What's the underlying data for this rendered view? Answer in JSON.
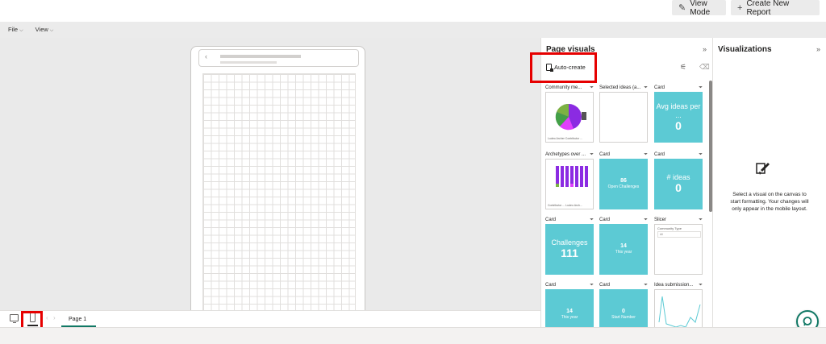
{
  "header": {
    "view_mode_label": "View Mode",
    "create_report_label": "Create New Report"
  },
  "menu": {
    "file_label": "File",
    "view_label": "View"
  },
  "status": {
    "page_tab_label": "Page 1"
  },
  "page_visuals": {
    "title": "Page visuals",
    "auto_create_label": "Auto-create",
    "tiles": [
      {
        "header": "Community me..."
      },
      {
        "header": "Selected ideas (a..."
      },
      {
        "header": "Card",
        "line1": "Avg ideas per ...",
        "value": "0"
      },
      {
        "header": "Archetypes over ..."
      },
      {
        "header": "Card",
        "value": "86",
        "caption": "Open Challenges"
      },
      {
        "header": "Card",
        "line1": "# ideas",
        "value": "0"
      },
      {
        "header": "Card",
        "line1": "Challenges",
        "value": "111"
      },
      {
        "header": "Card",
        "value": "14",
        "caption": "This year"
      },
      {
        "header": "Slicer",
        "slicer_label": "Community Type",
        "slicer_value": "All"
      },
      {
        "header": "Card",
        "value": "14",
        "caption": "This year"
      },
      {
        "header": "Card",
        "value": "0",
        "caption": "Start Number"
      },
      {
        "header": "Idea submission..."
      }
    ],
    "legend_pie": "Ludeo Archer  Contributor ...",
    "legend_bar": "Contributor ...  Ludeo Arch..."
  },
  "visualizations": {
    "title": "Visualizations",
    "message": "Select a visual on the canvas to start formatting. Your changes will only appear in the mobile layout."
  },
  "colors": {
    "card_teal": "#5ccad4",
    "purple": "#8b2be2",
    "magenta": "#e040fb",
    "green": "#7cb342",
    "highlight_red": "#e60000",
    "accent_green": "#117865"
  }
}
